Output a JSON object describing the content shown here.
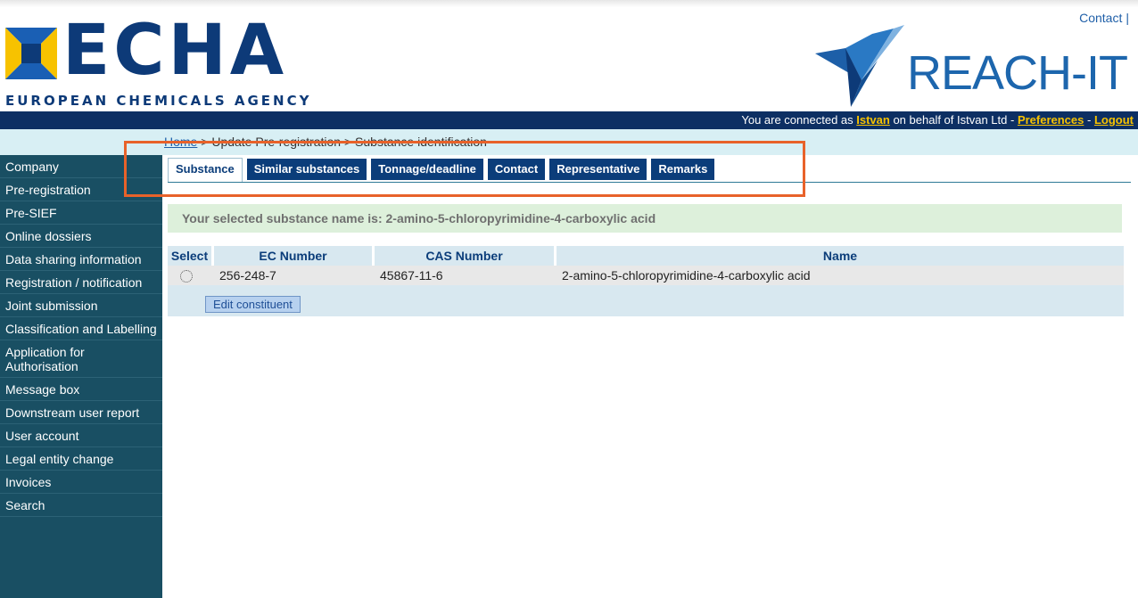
{
  "header": {
    "contact_link": "Contact",
    "echa_title": "ECHA",
    "echa_subtitle": "EUROPEAN CHEMICALS AGENCY",
    "reach_title": "REACH-IT"
  },
  "userbar": {
    "prefix": "You are connected as ",
    "user": "Istvan",
    "middle": " on behalf of Istvan Ltd - ",
    "preferences": "Preferences",
    "dash": " - ",
    "logout": "Logout"
  },
  "breadcrumb": {
    "home": "Home",
    "separator": " > ",
    "item1": "Update Pre-registration",
    "item2": "Substance identification"
  },
  "sidebar": {
    "items": [
      {
        "label": "Company"
      },
      {
        "label": "Pre-registration"
      },
      {
        "label": "Pre-SIEF"
      },
      {
        "label": "Online dossiers"
      },
      {
        "label": "Data sharing information"
      },
      {
        "label": "Registration / notification"
      },
      {
        "label": "Joint submission"
      },
      {
        "label": "Classification and Labelling"
      },
      {
        "label": "Application for Authorisation"
      },
      {
        "label": "Message box"
      },
      {
        "label": "Downstream user report"
      },
      {
        "label": "User account"
      },
      {
        "label": "Legal entity change"
      },
      {
        "label": "Invoices"
      },
      {
        "label": "Search"
      }
    ]
  },
  "tabs": [
    {
      "label": "Substance",
      "active": true
    },
    {
      "label": "Similar substances"
    },
    {
      "label": "Tonnage/deadline"
    },
    {
      "label": "Contact"
    },
    {
      "label": "Representative"
    },
    {
      "label": "Remarks"
    }
  ],
  "notice": {
    "text": "Your selected substance name is: 2-amino-5-chloropyrimidine-4-carboxylic acid"
  },
  "table": {
    "headers": [
      "Select",
      "EC Number",
      "CAS Number",
      "Name"
    ],
    "rows": [
      {
        "ec": "256-248-7",
        "cas": "45867-11-6",
        "name": "2-amino-5-chloropyrimidine-4-carboxylic acid"
      }
    ],
    "edit_button": "Edit constituent"
  },
  "colors": {
    "brand_dark": "#0d2f63",
    "sidebar": "#194f63",
    "tab": "#0b3d7a",
    "accent_yellow": "#f7c200",
    "highlight": "#e8622a"
  }
}
